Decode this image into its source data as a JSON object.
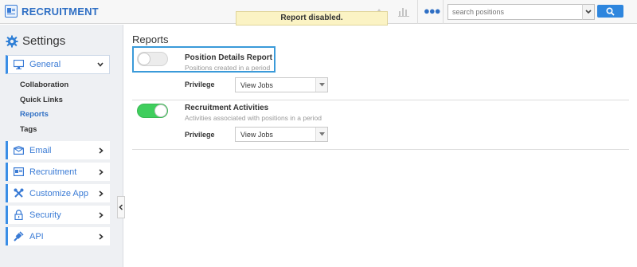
{
  "app": {
    "title": "RECRUITMENT"
  },
  "toast": {
    "message": "Report disabled."
  },
  "search": {
    "placeholder": "search positions",
    "value": ""
  },
  "sidebar": {
    "title": "Settings",
    "general_label": "General",
    "sub_items": [
      "Collaboration",
      "Quick Links",
      "Reports",
      "Tags"
    ],
    "active_sub_item": "Reports",
    "items": [
      "Email",
      "Recruitment",
      "Customize App",
      "Security",
      "API"
    ]
  },
  "main": {
    "section_title": "Reports",
    "privilege_label": "Privilege",
    "reports": [
      {
        "name": "Position Details Report",
        "description": "Positions created in a period",
        "enabled": false,
        "privilege": "View Jobs"
      },
      {
        "name": "Recruitment Activities",
        "description": "Activities associated with positions in a period",
        "enabled": true,
        "privilege": "View Jobs"
      }
    ]
  },
  "colors": {
    "accent": "#2f6fc4",
    "toggle_on": "#3fce5d",
    "focus": "#3a9ad9",
    "toast_bg": "#fbf3c4"
  }
}
